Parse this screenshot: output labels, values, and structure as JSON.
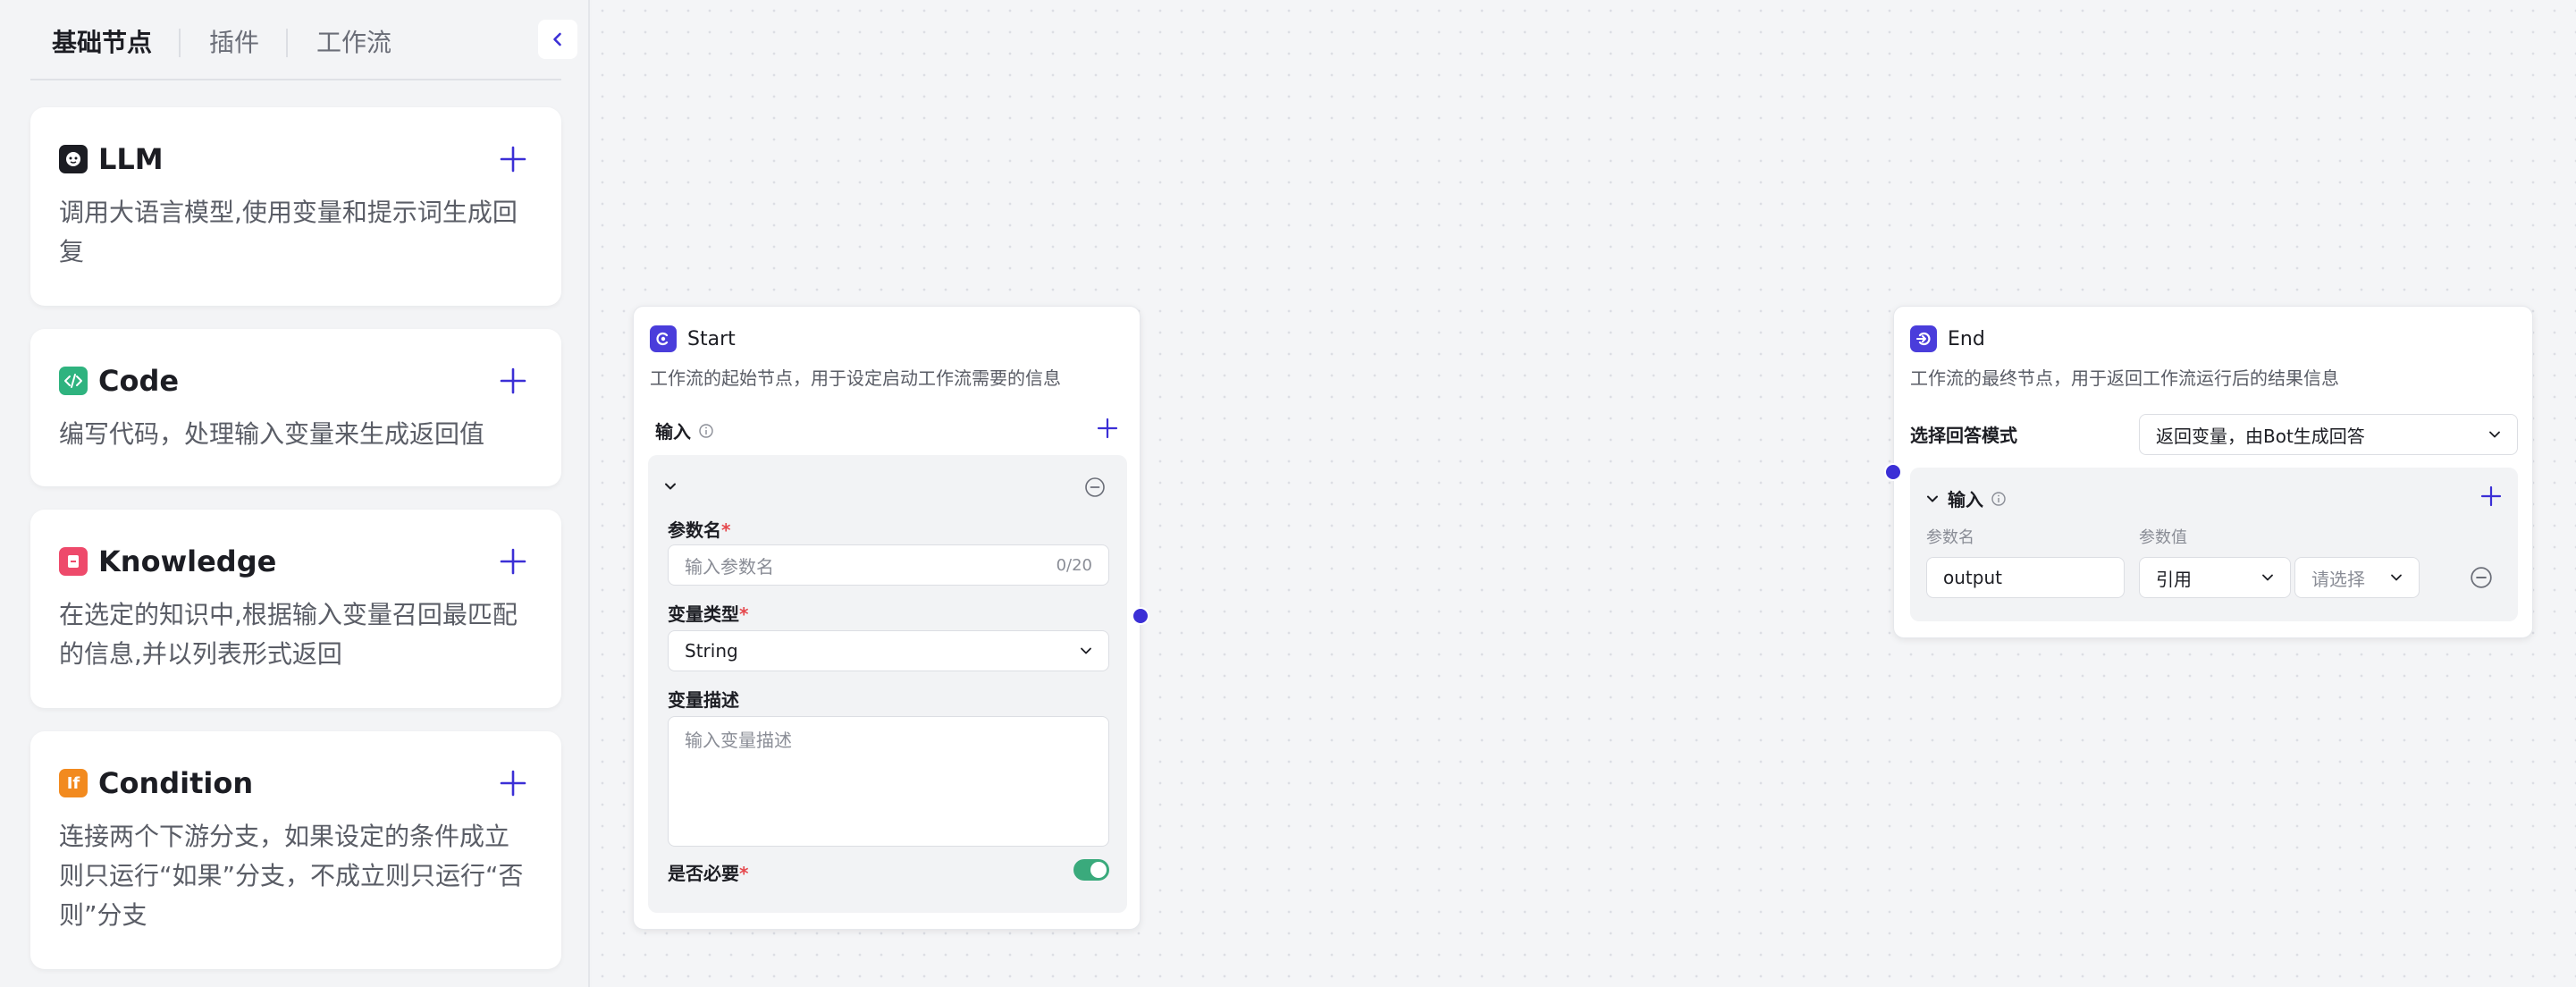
{
  "sidebar": {
    "tabs": [
      {
        "label": "基础节点",
        "active": true
      },
      {
        "label": "插件",
        "active": false
      },
      {
        "label": "工作流",
        "active": false
      }
    ],
    "nodes": [
      {
        "title": "LLM",
        "desc": "调用大语言模型,使用变量和提示词生成回复",
        "icon": "llm-icon",
        "color": "#1c1d23"
      },
      {
        "title": "Code",
        "desc": "编写代码，处理输入变量来生成返回值",
        "icon": "code-icon",
        "color": "#2fb37f"
      },
      {
        "title": "Knowledge",
        "desc": "在选定的知识中,根据输入变量召回最匹配的信息,并以列表形式返回",
        "icon": "knowledge-icon",
        "color": "#ee4a6b"
      },
      {
        "title": "Condition",
        "desc": "连接两个下游分支，如果设定的条件成立则只运行“如果”分支，不成立则只运行“否则”分支",
        "icon": "condition-icon",
        "icon_text": "If",
        "color": "#f28a1f"
      }
    ]
  },
  "start_node": {
    "title": "Start",
    "desc": "工作流的起始节点，用于设定启动工作流需要的信息",
    "input_label": "输入",
    "param_name_label": "参数名",
    "param_name_placeholder": "输入参数名",
    "param_name_counter": "0/20",
    "var_type_label": "变量类型",
    "var_type_value": "String",
    "var_desc_label": "变量描述",
    "var_desc_placeholder": "输入变量描述",
    "required_label": "是否必要",
    "required_on": true
  },
  "end_node": {
    "title": "End",
    "desc": "工作流的最终节点，用于返回工作流运行后的结果信息",
    "mode_label": "选择回答模式",
    "mode_value": "返回变量，由Bot生成回答",
    "input_label": "输入",
    "col_name": "参数名",
    "col_value": "参数值",
    "param_name_value": "output",
    "ref_value": "引用",
    "select_placeholder": "请选择"
  },
  "colors": {
    "accent": "#3b2fd6",
    "toggle_on": "#3aaa7c"
  }
}
